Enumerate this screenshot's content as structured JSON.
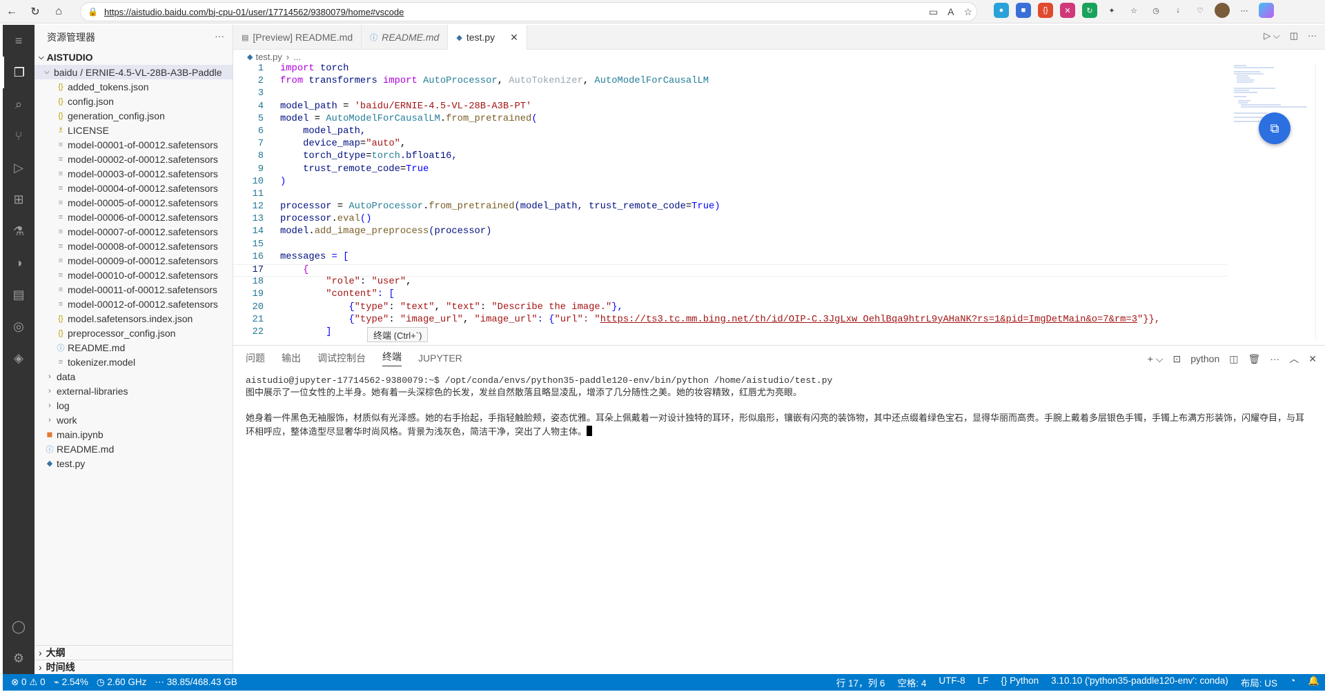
{
  "browser": {
    "url": "https://aistudio.baidu.com/bj-cpu-01/user/17714562/9380079/home#vscode"
  },
  "sidebar": {
    "title": "资源管理器",
    "root": "AISTUDIO",
    "folder": "baidu / ERNIE-4.5-VL-28B-A3B-Paddle",
    "files": [
      {
        "icon": "{}",
        "name": "added_tokens.json"
      },
      {
        "icon": "{}",
        "name": "config.json"
      },
      {
        "icon": "{}",
        "name": "generation_config.json"
      },
      {
        "icon": "♗",
        "name": "LICENSE"
      },
      {
        "icon": "≡",
        "name": "model-00001-of-00012.safetensors"
      },
      {
        "icon": "≡",
        "name": "model-00002-of-00012.safetensors"
      },
      {
        "icon": "≡",
        "name": "model-00003-of-00012.safetensors"
      },
      {
        "icon": "≡",
        "name": "model-00004-of-00012.safetensors"
      },
      {
        "icon": "≡",
        "name": "model-00005-of-00012.safetensors"
      },
      {
        "icon": "≡",
        "name": "model-00006-of-00012.safetensors"
      },
      {
        "icon": "≡",
        "name": "model-00007-of-00012.safetensors"
      },
      {
        "icon": "≡",
        "name": "model-00008-of-00012.safetensors"
      },
      {
        "icon": "≡",
        "name": "model-00009-of-00012.safetensors"
      },
      {
        "icon": "≡",
        "name": "model-00010-of-00012.safetensors"
      },
      {
        "icon": "≡",
        "name": "model-00011-of-00012.safetensors"
      },
      {
        "icon": "≡",
        "name": "model-00012-of-00012.safetensors"
      },
      {
        "icon": "{}",
        "name": "model.safetensors.index.json"
      },
      {
        "icon": "{}",
        "name": "preprocessor_config.json"
      },
      {
        "icon": "ⓘ",
        "name": "README.md"
      },
      {
        "icon": "≡",
        "name": "tokenizer.model"
      }
    ],
    "folders": [
      "data",
      "external-libraries",
      "log",
      "work"
    ],
    "root_files": [
      "main.ipynb",
      "README.md",
      "test.py"
    ],
    "sections": [
      "大纲",
      "时间线"
    ]
  },
  "tabs": [
    {
      "label": "[Preview] README.md"
    },
    {
      "label": "README.md"
    },
    {
      "label": "test.py"
    }
  ],
  "breadcrumb": {
    "file": "test.py",
    "rest": "..."
  },
  "code_lines": [
    "1",
    "2",
    "3",
    "4",
    "5",
    "6",
    "7",
    "8",
    "9",
    "10",
    "11",
    "12",
    "13",
    "14",
    "15",
    "16",
    "17",
    "18",
    "19",
    "20",
    "21",
    "22"
  ],
  "code_text": {
    "l1a": "import",
    "l1b": " torch",
    "l2a": "from",
    "l2b": " transformers ",
    "l2c": "import",
    "l2d": " AutoProcessor",
    "l2e": ", ",
    "l2f": "AutoTokenizer",
    "l2g": ", ",
    "l2h": "AutoModelForCausalLM",
    "l4a": "model_path",
    "l4b": " = ",
    "l4c": "'baidu/ERNIE-4.5-VL-28B-A3B-PT'",
    "l5a": "model",
    "l5b": " = ",
    "l5c": "AutoModelForCausalLM",
    "l5d": ".",
    "l5e": "from_pretrained",
    "l5f": "(",
    "l6": "    model_path,",
    "l7a": "    device_map",
    "l7b": "=",
    "l7c": "\"auto\"",
    "l7d": ",",
    "l8a": "    torch_dtype",
    "l8b": "=",
    "l8c": "torch",
    "l8d": ".bfloat16,",
    "l9a": "    trust_remote_code",
    "l9b": "=",
    "l9c": "True",
    "l10": ")",
    "l12a": "processor",
    "l12b": " = ",
    "l12c": "AutoProcessor",
    "l12d": ".",
    "l12e": "from_pretrained",
    "l12f": "(model_path, trust_remote_code",
    "l12g": "=",
    "l12h": "True",
    "l12i": ")",
    "l13a": "processor",
    "l13b": ".",
    "l13c": "eval",
    "l13d": "()",
    "l14a": "model",
    "l14b": ".",
    "l14c": "add_image_preprocess",
    "l14d": "(processor)",
    "l16a": "messages",
    "l16b": " = [",
    "l17": "    {",
    "l18a": "        \"role\"",
    "l18b": ": ",
    "l18c": "\"user\"",
    "l18d": ",",
    "l19a": "        \"content\"",
    "l19b": ": [",
    "l20a": "            {",
    "l20b": "\"type\"",
    "l20c": ": ",
    "l20d": "\"text\"",
    "l20e": ", ",
    "l20f": "\"text\"",
    "l20g": ": ",
    "l20h": "\"Describe the image.\"",
    "l20i": "},",
    "l21a": "            {",
    "l21b": "\"type\"",
    "l21c": ": ",
    "l21d": "\"image_url\"",
    "l21e": ", ",
    "l21f": "\"image_url\"",
    "l21g": ": {",
    "l21h": "\"url\"",
    "l21i": ": \"",
    "l21j": "https://ts3.tc.mm.bing.net/th/id/OIP-C.3JgLxw_OehlBqa9htrL9yAHaNK?rs=1&pid=ImgDetMain&o=7&rm=3",
    "l21k": "\"}},",
    "l22": "        ]"
  },
  "tooltip": "终端 (Ctrl+`)",
  "panel": {
    "tabs": [
      "问题",
      "输出",
      "调试控制台",
      "终端",
      "JUPYTER"
    ],
    "shell": "python",
    "terminal": [
      "aistudio@jupyter-17714562-9380079:~$ /opt/conda/envs/python35-paddle120-env/bin/python /home/aistudio/test.py",
      "图中展示了一位女性的上半身。她有着一头深棕色的长发，发丝自然散落且略显凌乱，增添了几分随性之美。她的妆容精致，红唇尤为亮眼。",
      "",
      "她身着一件黑色无袖服饰，材质似有光泽感。她的右手抬起，手指轻触脸颊，姿态优雅。耳朵上佩戴着一对设计独特的耳环，形似扇形，镶嵌有闪亮的装饰物，其中还点缀着绿色宝石，显得华丽而高贵。手腕上戴着多层银色手镯，手镯上布满方形装饰，闪耀夺目，与耳环相呼应，整体造型尽显奢华时尚风格。背景为浅灰色，简洁干净，突出了人物主体。"
    ]
  },
  "status": {
    "errors": "⊗ 0 ⚠ 0",
    "cpu": "2.54%",
    "freq": "2.60 GHz",
    "disk": "38.85/468.43 GB",
    "position": "行 17，列 6",
    "spaces": "空格: 4",
    "encoding": "UTF-8",
    "eol": "LF",
    "lang": "Python",
    "interpreter": "3.10.10 ('python35-paddle120-env': conda)",
    "layout": "布局: US"
  }
}
